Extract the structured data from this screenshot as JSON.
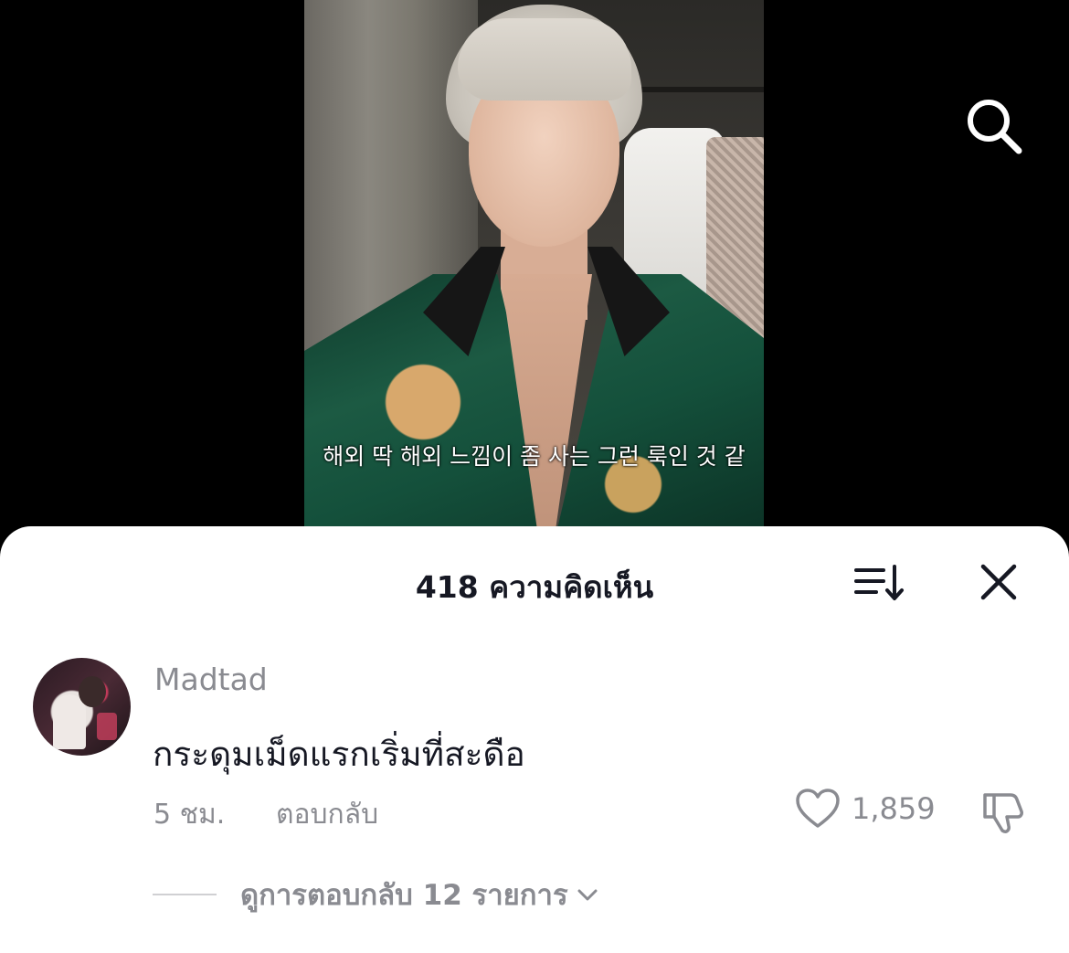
{
  "video": {
    "caption": "해외 딱 해외 느낌이 좀 사는 그런 룩인 것 같"
  },
  "icons": {
    "search": "search-icon",
    "sort": "sort-icon",
    "close": "close-icon",
    "like": "heart-icon",
    "dislike": "thumbs-down-icon",
    "expand": "chevron-down-icon"
  },
  "comments_panel": {
    "title": "418 ความคิดเห็น"
  },
  "comment": {
    "username": "Madtad",
    "text": "กระดุมเม็ดแรกเริ่มที่สะดือ",
    "time": "5 ชม.",
    "reply_label": "ตอบกลับ",
    "like_count": "1,859",
    "view_replies_label": "ดูการตอบกลับ 12 รายการ"
  },
  "colors": {
    "background_video": "#000000",
    "sheet": "#ffffff",
    "primary_text": "#161823",
    "secondary_text": "#8a8b91"
  }
}
